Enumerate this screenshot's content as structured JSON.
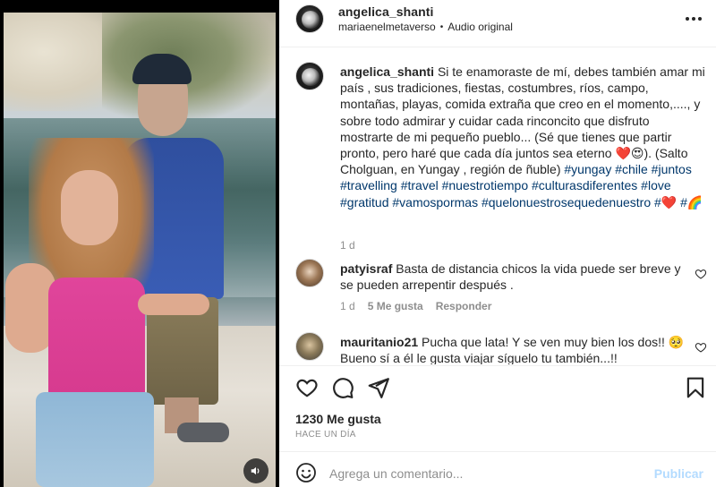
{
  "post": {
    "author": "angelica_shanti",
    "audio_collaborator": "mariaenelmetaverso",
    "audio_separator": "•",
    "audio_label": "Audio original"
  },
  "caption": {
    "username": "angelica_shanti",
    "text": "Si te enamoraste de mí, debes también amar mi país , sus tradiciones, fiestas, costumbres, ríos, campo, montañas, playas, comida extraña que creo en el momento,...., y sobre todo admirar y cuidar cada rinconcito que disfruto mostrarte de mi pequeño pueblo... (Sé que tienes que partir pronto, pero haré que cada día juntos sea eterno ❤️😍). (Salto Cholguan, en Yungay , región de ñuble)",
    "hashtags": "#yungay #chile #juntos #travelling #travel #nuestrotiempo #culturasdiferentes #love #gratitud #vamospormas #quelonuestrosequedenuestro #❤️ #🌈",
    "time": "1 d"
  },
  "comments": [
    {
      "username": "patyisraf",
      "text": "Basta de distancia chicos la vida puede ser breve y se pueden arrepentir después .",
      "time": "1 d",
      "likes": "5 Me gusta",
      "reply": "Responder"
    },
    {
      "username": "mauritanio21",
      "text": "Pucha que lata! Y se ven muy bien los dos!! 🥺 Bueno sí a él le gusta viajar síguelo tu también...!!"
    }
  ],
  "engagement": {
    "likes": "1230 Me gusta",
    "time_ago": "HACE UN DÍA"
  },
  "comment_box": {
    "placeholder": "Agrega un comentario...",
    "publish_label": "Publicar"
  },
  "icons": {
    "like": "heart-icon",
    "comment": "comment-icon",
    "share": "paper-plane-icon",
    "save": "bookmark-icon",
    "more": "more-dots-icon",
    "emoji": "emoji-icon",
    "sound": "speaker-icon"
  },
  "colors": {
    "hashtag": "#00376b",
    "publish_disabled": "#b3dbff",
    "secondary_text": "#8e8e8e"
  }
}
